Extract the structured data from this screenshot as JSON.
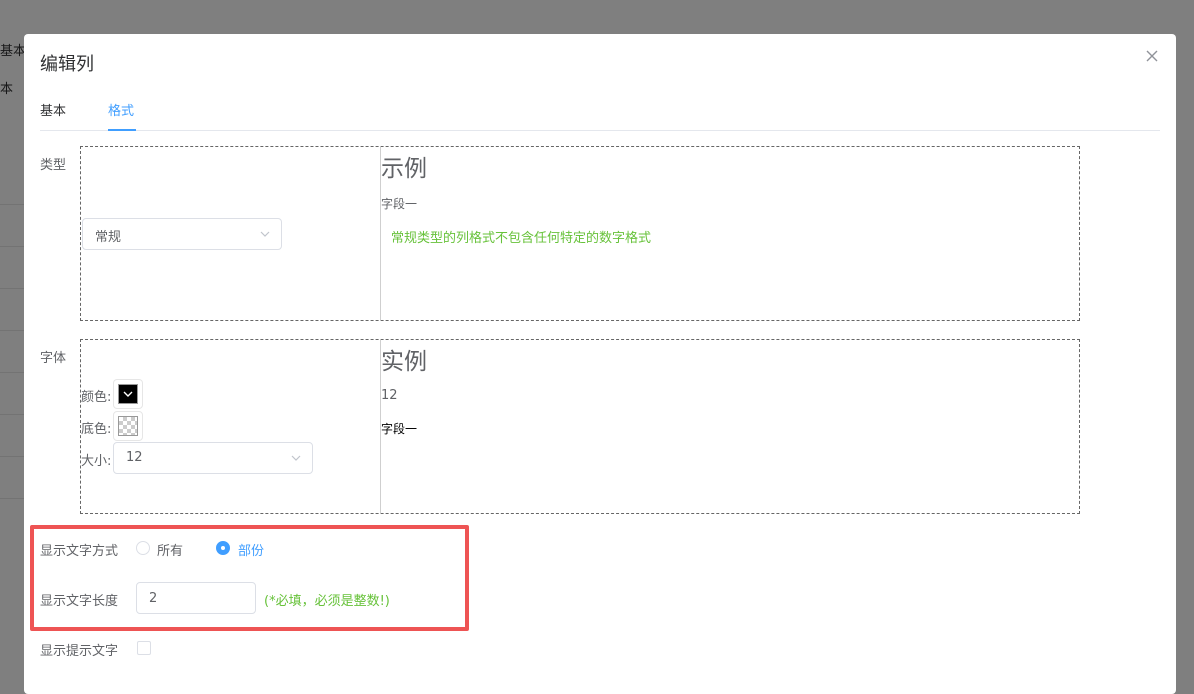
{
  "background": {
    "text1": "基本",
    "text2": "本"
  },
  "dialog": {
    "title": "编辑列",
    "tabs": [
      {
        "label": "基本",
        "active": false
      },
      {
        "label": "格式",
        "active": true
      }
    ]
  },
  "type_section": {
    "label": "类型",
    "select_value": "常规",
    "example_title": "示例",
    "sample_field": "字段一",
    "hint": "常规类型的列格式不包含任何特定的数字格式"
  },
  "font_section": {
    "label": "字体",
    "color_label": "颜色:",
    "bgcolor_label": "底色:",
    "size_label": "大小:",
    "size_value": "12",
    "colors": {
      "font": "#000000"
    },
    "example_title": "实例",
    "size_preview": "12",
    "sample_field": "字段一"
  },
  "display_mode": {
    "label": "显示文字方式",
    "options": [
      {
        "label": "所有",
        "checked": false
      },
      {
        "label": "部份",
        "checked": true
      }
    ]
  },
  "display_length": {
    "label": "显示文字长度",
    "value": "2",
    "hint": "(*必填，必须是整数!)"
  },
  "tooltip": {
    "label": "显示提示文字",
    "checked": false
  },
  "theme": {
    "primary": "#409eff",
    "success": "#67c23a",
    "highlight": "#ee5454"
  }
}
